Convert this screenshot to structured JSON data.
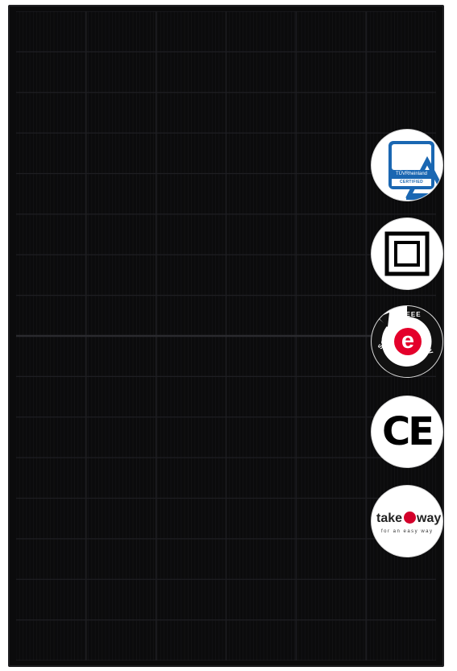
{
  "product": {
    "panel_color": "#0b0b0c",
    "cell_line_color": "#1e1e22"
  },
  "certifications": [
    {
      "name": "TÜV Rheinland",
      "brand_text": "TÜVRheinland",
      "label": "CERTIFIED",
      "color": "#1a67b2"
    },
    {
      "name": "Class II double insulation",
      "icon": "double-square-icon"
    },
    {
      "name": "WEEE Solar PV",
      "center": "e",
      "top": "WEEE",
      "left": "SOLAR",
      "right": "PV",
      "color": "#e4002b"
    },
    {
      "name": "CE",
      "text": "CE"
    },
    {
      "name": "take e way",
      "before": "take",
      "after": "way",
      "tagline": "for an easy way",
      "color": "#d3002a"
    }
  ]
}
